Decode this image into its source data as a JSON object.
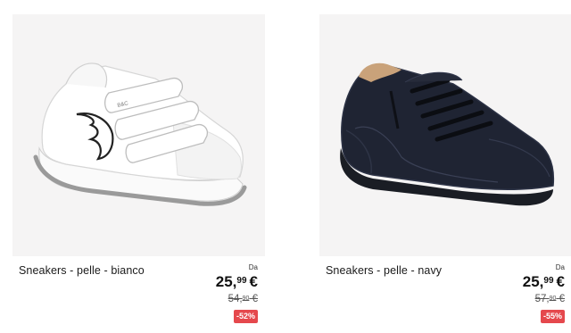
{
  "products": [
    {
      "name": "Sneakers - pelle - bianco",
      "price_from_label": "Da",
      "price_int": "25,",
      "price_dec": "99",
      "currency": "€",
      "old_price_int": "54,",
      "old_price_dec": "90",
      "old_currency": "€",
      "discount": "-52%",
      "image_icon": "white-velcro-sneaker-image"
    },
    {
      "name": "Sneakers - pelle - navy",
      "price_from_label": "Da",
      "price_int": "25,",
      "price_dec": "99",
      "currency": "€",
      "old_price_int": "57,",
      "old_price_dec": "90",
      "old_currency": "€",
      "discount": "-55%",
      "image_icon": "navy-leather-shoe-image"
    }
  ],
  "colors": {
    "discount_badge": "#e5484d",
    "image_background": "#f5f4f4",
    "text": "#1a1a1a"
  }
}
